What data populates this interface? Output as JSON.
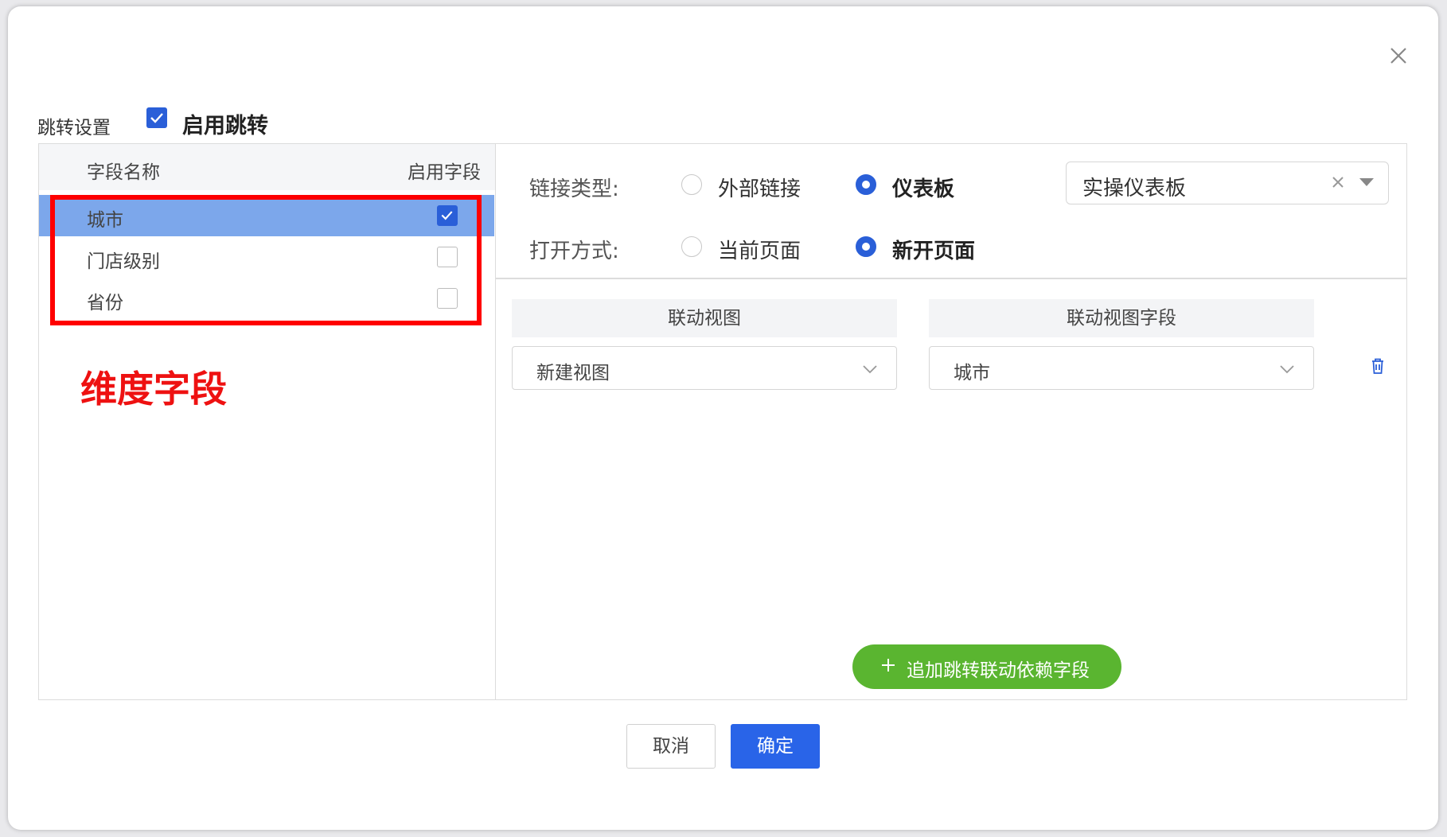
{
  "dialog": {
    "close_icon": "close-icon"
  },
  "jump": {
    "label": "跳转设置",
    "enable_label": "启用跳转",
    "enabled": true
  },
  "fields": {
    "header_name": "字段名称",
    "header_enable": "启用字段",
    "items": [
      {
        "name": "城市",
        "enabled": true,
        "selected": true
      },
      {
        "name": "门店级别",
        "enabled": false,
        "selected": false
      },
      {
        "name": "省份",
        "enabled": false,
        "selected": false
      }
    ],
    "annotation": "维度字段",
    "annotation_color": "#ee1111"
  },
  "link_type": {
    "label": "链接类型:",
    "option_external": "外部链接",
    "option_dashboard": "仪表板",
    "selected": "仪表板",
    "dashboard_value": "实操仪表板"
  },
  "open_mode": {
    "label": "打开方式:",
    "option_current": "当前页面",
    "option_new": "新开页面",
    "selected": "新开页面"
  },
  "linkage": {
    "header_view": "联动视图",
    "header_field": "联动视图字段",
    "view_value": "新建视图",
    "field_value": "城市",
    "add_label": "追加跳转联动依赖字段"
  },
  "footer": {
    "cancel_label": "取消",
    "ok_label": "确定"
  },
  "colors": {
    "primary": "#2a5fd8",
    "selected_row": "#7ca7eb",
    "add_button": "#5ab530",
    "highlight_border": "#ff0000"
  }
}
